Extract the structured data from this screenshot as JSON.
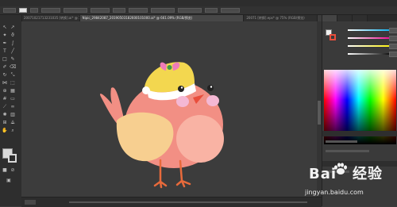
{
  "tabs": [
    {
      "label": "20071021713231035 [转换].ai* @ 100% (RGB/预览)",
      "active": false
    },
    {
      "label": "Nipic_29842087_20190503182600101000.ai* @ 661.09% (RGB/预览)",
      "active": true
    },
    {
      "label": "20071 [转换].eps* @ 75% (RGB/预览)",
      "active": false
    }
  ],
  "watermark": {
    "brand": "Bai",
    "brand2": "经验",
    "url": "jingyan.baidu.com"
  },
  "colors": {
    "canvas": "#3c3c3c",
    "bird_body": "#f28f84",
    "bird_wing": "#f7cf90",
    "bird_belly": "#f9b3a4",
    "hat": "#f3d74f",
    "bow": "#f07cb8",
    "legs": "#e86a3b",
    "beak": "#e94e3c",
    "cheek": "#f4b8d4"
  }
}
